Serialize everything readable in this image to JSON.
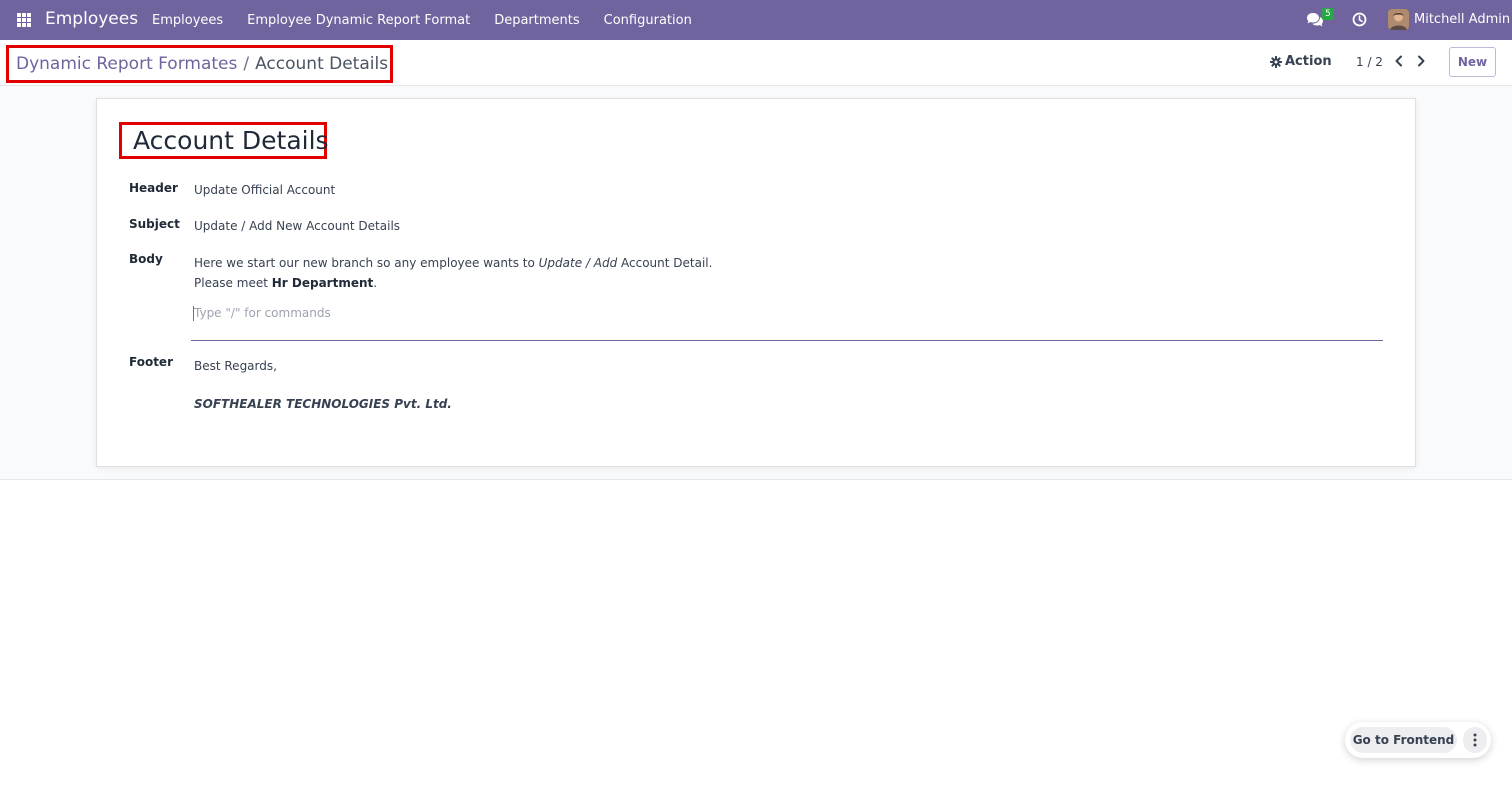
{
  "navbar": {
    "brand": "Employees",
    "menu": [
      "Employees",
      "Employee Dynamic Report Format",
      "Departments",
      "Configuration"
    ],
    "chat_badge": "5",
    "user_name": "Mitchell Admin",
    "bg_color": "#71639e"
  },
  "control": {
    "breadcrumb_parent": "Dynamic Report Formates",
    "breadcrumb_sep": "/",
    "breadcrumb_current": "Account Details",
    "action_label": "Action",
    "pager": "1 / 2",
    "new_label": "New"
  },
  "form": {
    "title": "Account Details",
    "header_label": "Header",
    "header_value": "Update Official Account",
    "subject_label": "Subject",
    "subject_value": "Update / Add New Account Details",
    "body_label": "Body",
    "body_line1_pre": "Here we start our new branch so any employee wants to ",
    "body_line1_italic": "Update / Add",
    "body_line1_post": " Account Detail.",
    "body_line2_pre": "Please meet ",
    "body_line2_bold": "Hr Department",
    "body_line2_post": ".",
    "body_placeholder": "Type \"/\" for commands",
    "footer_label": "Footer",
    "footer_line1": "Best Regards,",
    "footer_company": "SOFTHEALER TECHNOLOGIES Pvt. Ltd."
  },
  "widget": {
    "frontend_label": "Go to Frontend"
  }
}
